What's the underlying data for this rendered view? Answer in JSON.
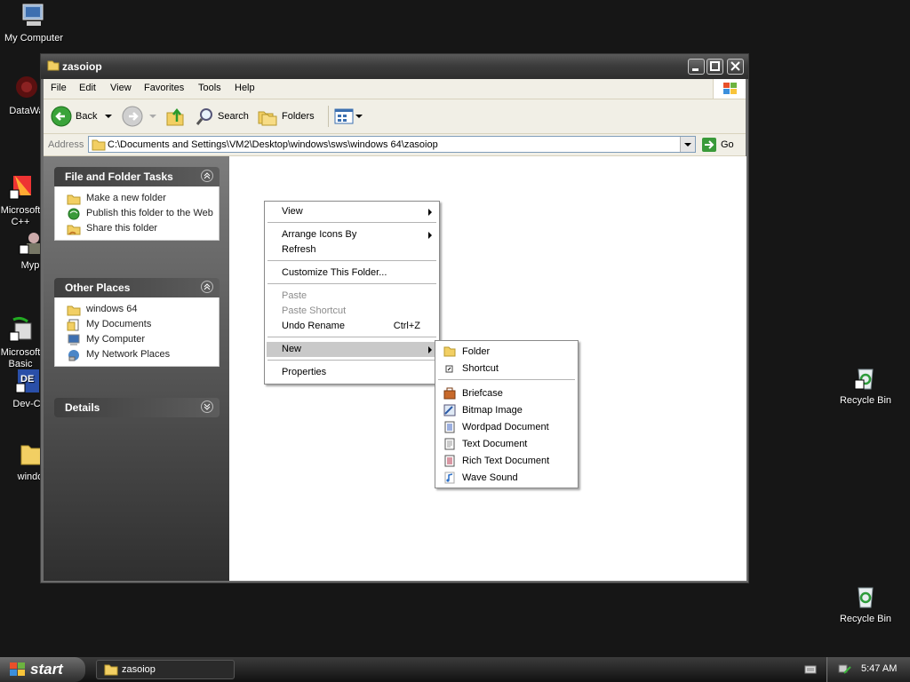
{
  "desktop": {
    "icons": [
      {
        "label": "My Computer",
        "icon": "my-computer-icon"
      },
      {
        "label": "DataWa",
        "icon": "datawarehouse-icon"
      },
      {
        "label": "Microsoft\nC++",
        "icon": "microsoft-cpp-icon"
      },
      {
        "label": "Myp",
        "icon": "myp-icon"
      },
      {
        "label": "Microsoft\nBasic",
        "icon": "microsoft-basic-icon"
      },
      {
        "label": "Dev-C",
        "icon": "dev-cpp-icon"
      },
      {
        "label": "windo",
        "icon": "folder-icon"
      },
      {
        "label": "Recycle Bin",
        "icon": "recycle-bin-icon"
      },
      {
        "label": "Recycle Bin",
        "icon": "recycle-bin-icon"
      }
    ]
  },
  "window": {
    "title": "zasoiop",
    "menu": [
      "File",
      "Edit",
      "View",
      "Favorites",
      "Tools",
      "Help"
    ],
    "toolbar": {
      "back": "Back",
      "search": "Search",
      "folders": "Folders"
    },
    "address": {
      "label": "Address",
      "path": "C:\\Documents and Settings\\VM2\\Desktop\\windows\\sws\\windows 64\\zasoiop",
      "go": "Go"
    },
    "tasks_panel": {
      "title": "File and Folder Tasks",
      "items": [
        "Make a new folder",
        "Publish this folder to the Web",
        "Share this folder"
      ]
    },
    "places_panel": {
      "title": "Other Places",
      "items": [
        "windows 64",
        "My Documents",
        "My Computer",
        "My Network Places"
      ]
    },
    "details_panel": {
      "title": "Details"
    }
  },
  "context_menu": {
    "view": "View",
    "arrange": "Arrange Icons By",
    "refresh": "Refresh",
    "customize": "Customize This Folder...",
    "paste": "Paste",
    "paste_shortcut": "Paste Shortcut",
    "undo": "Undo Rename",
    "undo_shortcut": "Ctrl+Z",
    "new": "New",
    "properties": "Properties"
  },
  "new_submenu": {
    "folder": "Folder",
    "shortcut": "Shortcut",
    "briefcase": "Briefcase",
    "bitmap": "Bitmap Image",
    "wordpad": "Wordpad Document",
    "text": "Text Document",
    "rtf": "Rich Text Document",
    "wave": "Wave Sound"
  },
  "taskbar": {
    "start": "start",
    "task": "zasoiop",
    "clock": "5:47 AM"
  },
  "colors": {
    "folder": "#f5d36b",
    "highlight": "#c9c9c9",
    "go_green": "#3a9a3a"
  }
}
